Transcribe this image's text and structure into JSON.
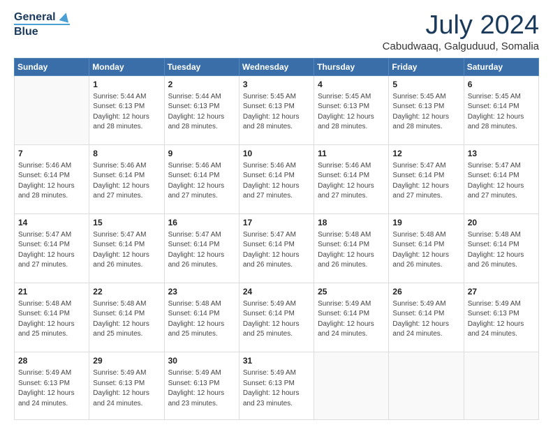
{
  "logo": {
    "line1": "General",
    "line2": "Blue"
  },
  "title": "July 2024",
  "subtitle": "Cabudwaaq, Galguduud, Somalia",
  "weekdays": [
    "Sunday",
    "Monday",
    "Tuesday",
    "Wednesday",
    "Thursday",
    "Friday",
    "Saturday"
  ],
  "weeks": [
    [
      {
        "day": "",
        "info": ""
      },
      {
        "day": "1",
        "info": "Sunrise: 5:44 AM\nSunset: 6:13 PM\nDaylight: 12 hours\nand 28 minutes."
      },
      {
        "day": "2",
        "info": "Sunrise: 5:44 AM\nSunset: 6:13 PM\nDaylight: 12 hours\nand 28 minutes."
      },
      {
        "day": "3",
        "info": "Sunrise: 5:45 AM\nSunset: 6:13 PM\nDaylight: 12 hours\nand 28 minutes."
      },
      {
        "day": "4",
        "info": "Sunrise: 5:45 AM\nSunset: 6:13 PM\nDaylight: 12 hours\nand 28 minutes."
      },
      {
        "day": "5",
        "info": "Sunrise: 5:45 AM\nSunset: 6:13 PM\nDaylight: 12 hours\nand 28 minutes."
      },
      {
        "day": "6",
        "info": "Sunrise: 5:45 AM\nSunset: 6:14 PM\nDaylight: 12 hours\nand 28 minutes."
      }
    ],
    [
      {
        "day": "7",
        "info": "Sunrise: 5:46 AM\nSunset: 6:14 PM\nDaylight: 12 hours\nand 28 minutes."
      },
      {
        "day": "8",
        "info": "Sunrise: 5:46 AM\nSunset: 6:14 PM\nDaylight: 12 hours\nand 27 minutes."
      },
      {
        "day": "9",
        "info": "Sunrise: 5:46 AM\nSunset: 6:14 PM\nDaylight: 12 hours\nand 27 minutes."
      },
      {
        "day": "10",
        "info": "Sunrise: 5:46 AM\nSunset: 6:14 PM\nDaylight: 12 hours\nand 27 minutes."
      },
      {
        "day": "11",
        "info": "Sunrise: 5:46 AM\nSunset: 6:14 PM\nDaylight: 12 hours\nand 27 minutes."
      },
      {
        "day": "12",
        "info": "Sunrise: 5:47 AM\nSunset: 6:14 PM\nDaylight: 12 hours\nand 27 minutes."
      },
      {
        "day": "13",
        "info": "Sunrise: 5:47 AM\nSunset: 6:14 PM\nDaylight: 12 hours\nand 27 minutes."
      }
    ],
    [
      {
        "day": "14",
        "info": "Sunrise: 5:47 AM\nSunset: 6:14 PM\nDaylight: 12 hours\nand 27 minutes."
      },
      {
        "day": "15",
        "info": "Sunrise: 5:47 AM\nSunset: 6:14 PM\nDaylight: 12 hours\nand 26 minutes."
      },
      {
        "day": "16",
        "info": "Sunrise: 5:47 AM\nSunset: 6:14 PM\nDaylight: 12 hours\nand 26 minutes."
      },
      {
        "day": "17",
        "info": "Sunrise: 5:47 AM\nSunset: 6:14 PM\nDaylight: 12 hours\nand 26 minutes."
      },
      {
        "day": "18",
        "info": "Sunrise: 5:48 AM\nSunset: 6:14 PM\nDaylight: 12 hours\nand 26 minutes."
      },
      {
        "day": "19",
        "info": "Sunrise: 5:48 AM\nSunset: 6:14 PM\nDaylight: 12 hours\nand 26 minutes."
      },
      {
        "day": "20",
        "info": "Sunrise: 5:48 AM\nSunset: 6:14 PM\nDaylight: 12 hours\nand 26 minutes."
      }
    ],
    [
      {
        "day": "21",
        "info": "Sunrise: 5:48 AM\nSunset: 6:14 PM\nDaylight: 12 hours\nand 25 minutes."
      },
      {
        "day": "22",
        "info": "Sunrise: 5:48 AM\nSunset: 6:14 PM\nDaylight: 12 hours\nand 25 minutes."
      },
      {
        "day": "23",
        "info": "Sunrise: 5:48 AM\nSunset: 6:14 PM\nDaylight: 12 hours\nand 25 minutes."
      },
      {
        "day": "24",
        "info": "Sunrise: 5:49 AM\nSunset: 6:14 PM\nDaylight: 12 hours\nand 25 minutes."
      },
      {
        "day": "25",
        "info": "Sunrise: 5:49 AM\nSunset: 6:14 PM\nDaylight: 12 hours\nand 24 minutes."
      },
      {
        "day": "26",
        "info": "Sunrise: 5:49 AM\nSunset: 6:14 PM\nDaylight: 12 hours\nand 24 minutes."
      },
      {
        "day": "27",
        "info": "Sunrise: 5:49 AM\nSunset: 6:13 PM\nDaylight: 12 hours\nand 24 minutes."
      }
    ],
    [
      {
        "day": "28",
        "info": "Sunrise: 5:49 AM\nSunset: 6:13 PM\nDaylight: 12 hours\nand 24 minutes."
      },
      {
        "day": "29",
        "info": "Sunrise: 5:49 AM\nSunset: 6:13 PM\nDaylight: 12 hours\nand 24 minutes."
      },
      {
        "day": "30",
        "info": "Sunrise: 5:49 AM\nSunset: 6:13 PM\nDaylight: 12 hours\nand 23 minutes."
      },
      {
        "day": "31",
        "info": "Sunrise: 5:49 AM\nSunset: 6:13 PM\nDaylight: 12 hours\nand 23 minutes."
      },
      {
        "day": "",
        "info": ""
      },
      {
        "day": "",
        "info": ""
      },
      {
        "day": "",
        "info": ""
      }
    ]
  ]
}
